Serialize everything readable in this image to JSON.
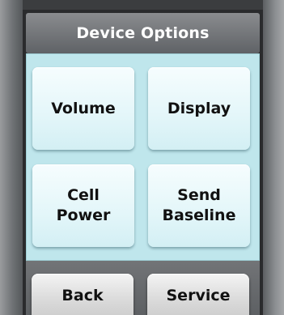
{
  "header": {
    "title": "Device Options"
  },
  "tiles": [
    {
      "label": "Volume"
    },
    {
      "label": "Display"
    },
    {
      "label": "Cell\nPower"
    },
    {
      "label": "Send\nBaseline"
    }
  ],
  "footer": {
    "back_label": "Back",
    "service_label": "Service"
  }
}
